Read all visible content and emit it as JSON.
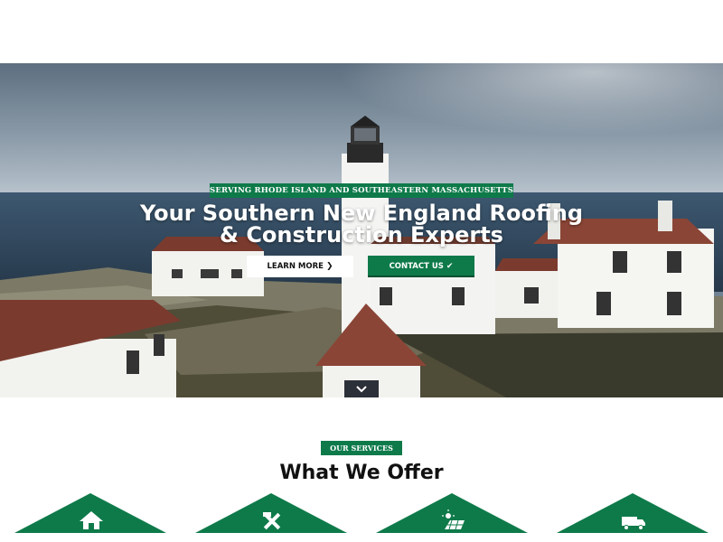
{
  "hero": {
    "tagline": "SERVING RHODE ISLAND AND SOUTHEASTERN MASSACHUSETTS",
    "title_line1": "Your Southern New England Roofing",
    "title_line2": "& Construction Experts",
    "learn_more_label": "LEARN MORE",
    "learn_more_icon": "chevron-right-icon",
    "contact_label": "CONTACT US",
    "contact_icon": "check-icon",
    "scroll_icon": "chevron-down-icon"
  },
  "services": {
    "badge": "OUR SERVICES",
    "title": "What We Offer",
    "tiles": [
      {
        "icon": "house-icon"
      },
      {
        "icon": "tools-icon"
      },
      {
        "icon": "solar-panel-icon"
      },
      {
        "icon": "truck-icon"
      }
    ]
  },
  "colors": {
    "brand_green": "#0e7a4a",
    "dark_green": "#064f2f",
    "white": "#ffffff",
    "text_dark": "#111111",
    "scroll_button": "#2c3038"
  }
}
